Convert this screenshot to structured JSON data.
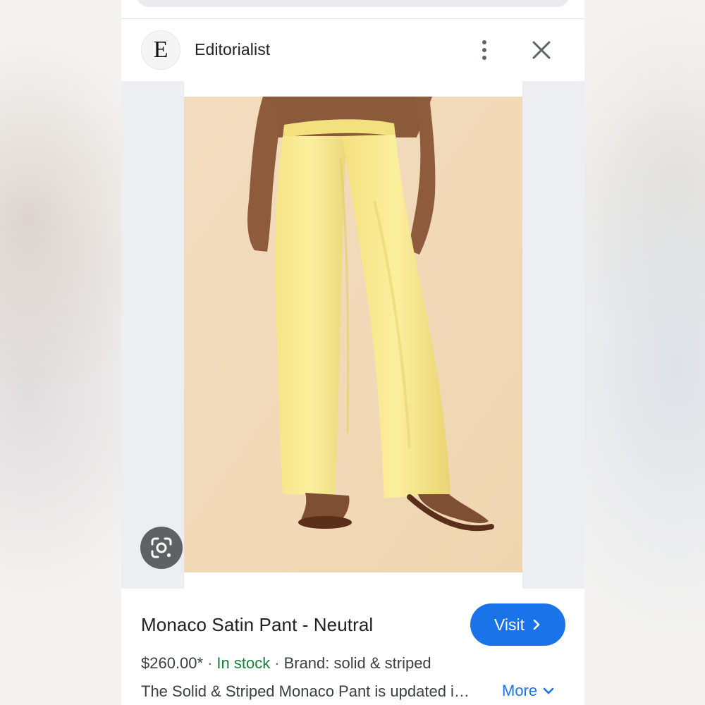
{
  "source": {
    "logo_letter": "E",
    "name": "Editorialist",
    "menu_icon": "more-vert-icon",
    "close_icon": "close-icon"
  },
  "image": {
    "lens_icon": "google-lens-icon",
    "colors": {
      "backdrop": "#f0d9b8",
      "pants": "#f3e48a",
      "sandals": "#6a3a22"
    }
  },
  "product": {
    "title": "Monaco Satin Pant - Neutral",
    "price": "$260.00*",
    "separator": "·",
    "stock": "In stock",
    "brand": "Brand: solid & striped",
    "description": "The Solid & Striped Monaco Pant is updated i…",
    "more_label": "More"
  },
  "actions": {
    "visit_label": "Visit"
  },
  "colors": {
    "accent": "#1a73e8",
    "in_stock": "#188038",
    "text": "#202124"
  }
}
